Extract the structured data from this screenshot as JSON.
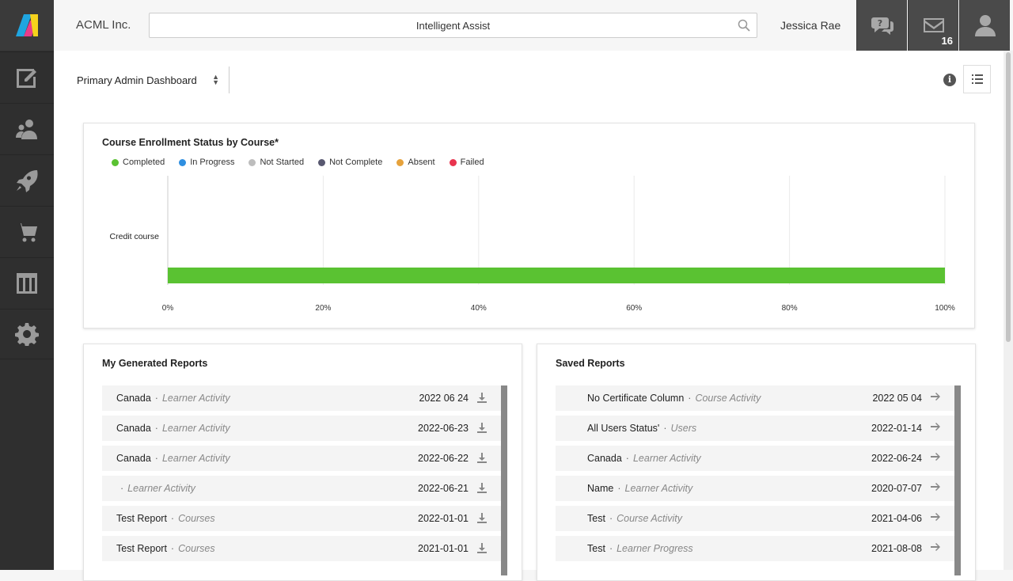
{
  "topbar": {
    "company": "ACML Inc.",
    "search_label": "Intelligent Assist",
    "username": "Jessica Rae",
    "mail_count": "16"
  },
  "sidebar": {
    "items": [
      {
        "icon": "edit-board-icon"
      },
      {
        "icon": "users-icon"
      },
      {
        "icon": "rocket-icon"
      },
      {
        "icon": "cart-icon"
      },
      {
        "icon": "columns-icon"
      },
      {
        "icon": "gear-icon"
      }
    ]
  },
  "dashboard": {
    "selected": "Primary Admin Dashboard"
  },
  "chart_card": {
    "title": "Course Enrollment Status by Course*"
  },
  "chart_data": {
    "type": "bar",
    "orientation": "horizontal",
    "stacked": true,
    "categories": [
      "Credit course"
    ],
    "series": [
      {
        "name": "Completed",
        "color": "#5ac232",
        "values": [
          100
        ]
      },
      {
        "name": "In Progress",
        "color": "#2f8fe0",
        "values": [
          0
        ]
      },
      {
        "name": "Not Started",
        "color": "#bdbdbd",
        "values": [
          0
        ]
      },
      {
        "name": "Not Complete",
        "color": "#585870",
        "values": [
          0
        ]
      },
      {
        "name": "Absent",
        "color": "#e6a23c",
        "values": [
          0
        ]
      },
      {
        "name": "Failed",
        "color": "#e8344e",
        "values": [
          0
        ]
      }
    ],
    "xticks": [
      "0%",
      "20%",
      "40%",
      "60%",
      "80%",
      "100%"
    ],
    "xlim": [
      0,
      100
    ],
    "grid": true,
    "legend": "top-left"
  },
  "generated_reports": {
    "title": "My Generated Reports",
    "rows": [
      {
        "name": "Canada",
        "type": "Learner Activity",
        "date": "2022 06 24"
      },
      {
        "name": "Canada",
        "type": "Learner Activity",
        "date": "2022-06-23"
      },
      {
        "name": "Canada",
        "type": "Learner Activity",
        "date": "2022-06-22"
      },
      {
        "name": "",
        "type": "Learner Activity",
        "date": "2022-06-21"
      },
      {
        "name": "Test Report",
        "type": "Courses",
        "date": "2022-01-01"
      },
      {
        "name": "Test Report",
        "type": "Courses",
        "date": "2021-01-01"
      }
    ]
  },
  "saved_reports": {
    "title": "Saved Reports",
    "rows": [
      {
        "name": "No Certificate Column",
        "type": "Course Activity",
        "date": "2022 05 04"
      },
      {
        "name": "All Users Status'",
        "type": "Users",
        "date": "2022-01-14"
      },
      {
        "name": "Canada",
        "type": "Learner Activity",
        "date": "2022-06-24"
      },
      {
        "name": "Name",
        "type": "Learner Activity",
        "date": "2020-07-07"
      },
      {
        "name": "Test",
        "type": "Course Activity",
        "date": "2021-04-06"
      },
      {
        "name": "Test",
        "type": "Learner Progress",
        "date": "2021-08-08"
      }
    ]
  }
}
